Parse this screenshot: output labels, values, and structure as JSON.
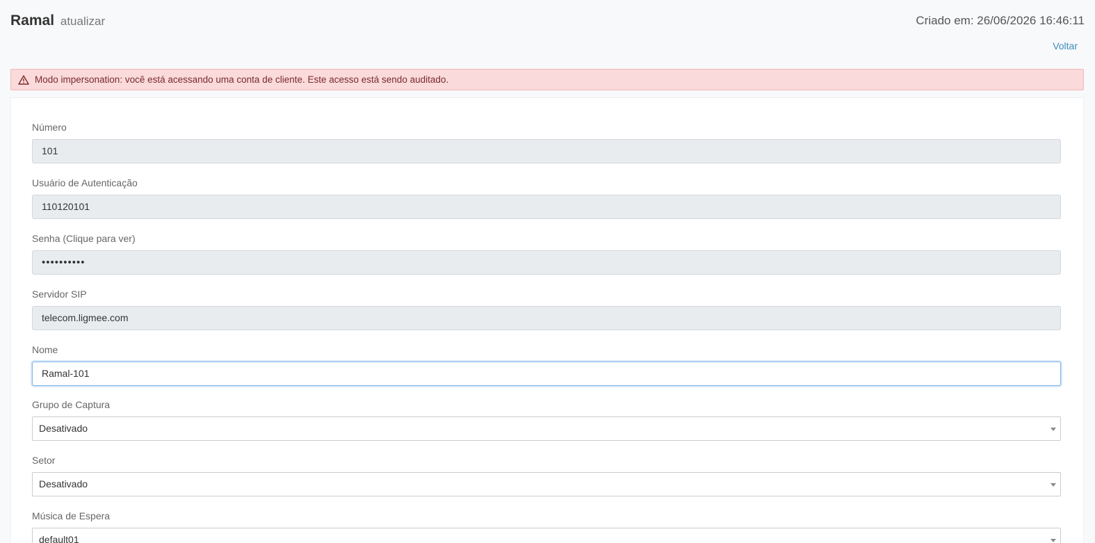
{
  "header": {
    "title": "Ramal",
    "subtitle": "atualizar",
    "created": "Criado em: 26/06/2026 16:46:11",
    "back_label": "Voltar"
  },
  "alert": {
    "icon": "warning-triangle-icon",
    "text": "Modo impersonation: você está acessando uma conta de cliente. Este acesso está sendo auditado.",
    "color": "#fadada"
  },
  "form": {
    "numero": {
      "label": "Número",
      "value": "101"
    },
    "usuario": {
      "label": "Usuário de Autenticação",
      "value": "110120101"
    },
    "senha": {
      "label": "Senha (Clique para ver)",
      "value": "••••••••••"
    },
    "servidor": {
      "label": "Servidor SIP",
      "value": "telecom.ligmee.com"
    },
    "nome": {
      "label": "Nome",
      "value": "Ramal-101"
    },
    "grupo": {
      "label": "Grupo de Captura",
      "value": "Desativado"
    },
    "setor": {
      "label": "Setor",
      "value": "Desativado"
    },
    "musica": {
      "label": "Música de Espera",
      "value": "default01"
    }
  },
  "colors": {
    "link": "#3c8dbc",
    "readonly_bg": "#e9ecef",
    "focus_border": "#80b4e6"
  }
}
